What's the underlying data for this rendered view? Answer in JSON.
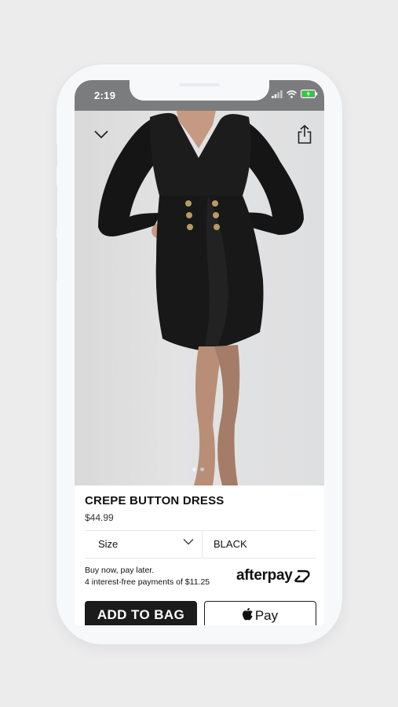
{
  "status": {
    "time": "2:19"
  },
  "product": {
    "title": "CREPE BUTTON DRESS",
    "price": "$44.99",
    "image_alt": "black dress"
  },
  "gallery": {
    "active_index": 0,
    "count": 2
  },
  "selectors": {
    "size_label": "Size",
    "color_value": "BLACK"
  },
  "bnpl": {
    "line1": "Buy now, pay later.",
    "line2": "4 interest-free payments of $11.25",
    "brand": "afterpay"
  },
  "actions": {
    "add_to_bag": "ADD TO BAG",
    "apple_pay": "Pay"
  },
  "icons": [
    "chevron-down-icon",
    "share-icon",
    "apple-icon",
    "afterpay-logo",
    "signal-icon",
    "wifi-icon",
    "battery-icon"
  ],
  "colors": {
    "statusbar": "#7b7c7e",
    "button_dark": "#1b1b1b",
    "background": "#ececed",
    "charging": "#2ecc40"
  }
}
